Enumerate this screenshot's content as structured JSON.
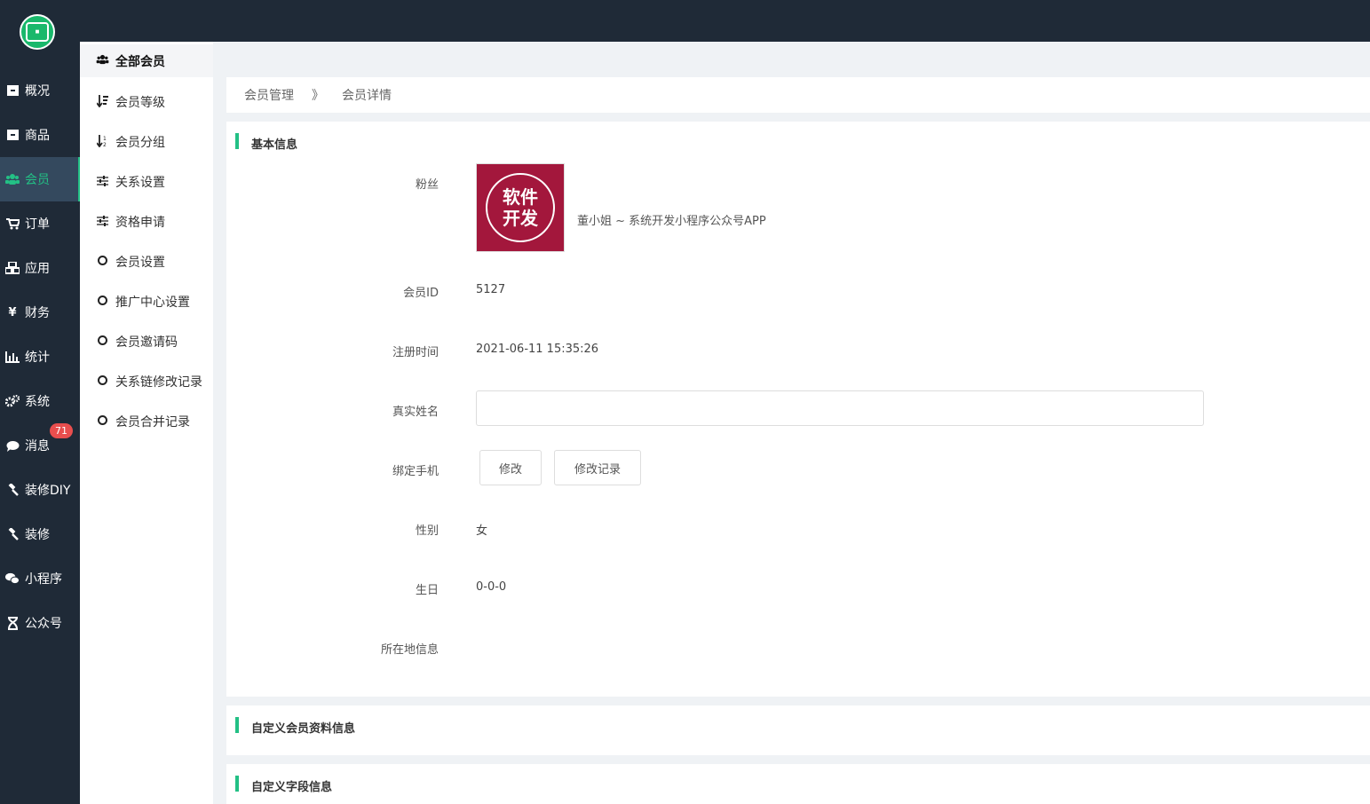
{
  "nav": {
    "items": [
      {
        "label": "概况",
        "icon": "archive-icon"
      },
      {
        "label": "商品",
        "icon": "archive-icon"
      },
      {
        "label": "会员",
        "icon": "users-icon"
      },
      {
        "label": "订单",
        "icon": "cart-icon"
      },
      {
        "label": "应用",
        "icon": "cubes-icon"
      },
      {
        "label": "财务",
        "icon": "yen-icon"
      },
      {
        "label": "统计",
        "icon": "bar-chart-icon"
      },
      {
        "label": "系统",
        "icon": "gears-icon"
      },
      {
        "label": "消息",
        "icon": "comment-icon"
      },
      {
        "label": "装修DIY",
        "icon": "gavel-icon"
      },
      {
        "label": "装修",
        "icon": "gavel-icon"
      },
      {
        "label": "小程序",
        "icon": "wechat-icon"
      },
      {
        "label": "公众号",
        "icon": "hourglass-icon"
      }
    ],
    "message_badge": "71"
  },
  "subnav": {
    "items": [
      {
        "label": "全部会员",
        "icon": "users-icon"
      },
      {
        "label": "会员等级",
        "icon": "sort-amount-icon"
      },
      {
        "label": "会员分组",
        "icon": "sort-numeric-icon"
      },
      {
        "label": "关系设置",
        "icon": "sliders-icon"
      },
      {
        "label": "资格申请",
        "icon": "sliders-icon"
      },
      {
        "label": "会员设置",
        "icon": "circle-icon"
      },
      {
        "label": "推广中心设置",
        "icon": "circle-icon"
      },
      {
        "label": "会员邀请码",
        "icon": "circle-icon"
      },
      {
        "label": "关系链修改记录",
        "icon": "circle-icon"
      },
      {
        "label": "会员合并记录",
        "icon": "circle-icon"
      }
    ]
  },
  "breadcrumb": {
    "first": "会员管理",
    "separator": "》",
    "second": "会员详情"
  },
  "basic": {
    "title": "基本信息",
    "fans_label": "粉丝",
    "avatar_text_1": "软件",
    "avatar_text_2": "开发",
    "fans_name": "董小姐 ~ 系统开发小程序公众号APP",
    "member_id_label": "会员ID",
    "member_id": "5127",
    "reg_time_label": "注册时间",
    "reg_time": "2021-06-11 15:35:26",
    "real_name_label": "真实姓名",
    "real_name_value": "",
    "phone_label": "绑定手机",
    "modify_button": "修改",
    "modify_log_button": "修改记录",
    "gender_label": "性别",
    "gender": "女",
    "birthday_label": "生日",
    "birthday": "0-0-0",
    "location_label": "所在地信息"
  },
  "custom_profile": {
    "title": "自定义会员资料信息"
  },
  "custom_fields": {
    "title": "自定义字段信息"
  },
  "colors": {
    "sidebar": "#1f2a37",
    "accent": "#23c085",
    "badge": "#e94e4e",
    "avatar_bg": "#a3173c"
  }
}
